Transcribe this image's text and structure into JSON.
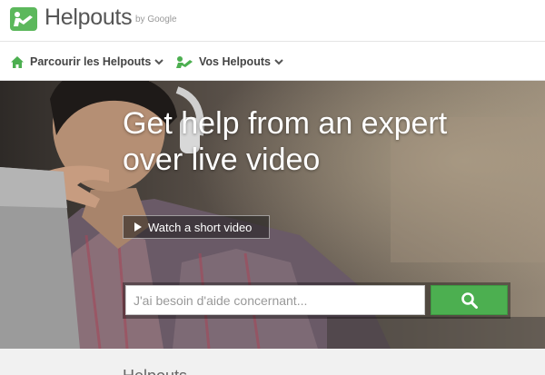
{
  "brand": {
    "name": "Helpouts",
    "by_label": "by Google",
    "accent_color": "#4caf50"
  },
  "nav": {
    "browse_label": "Parcourir les Helpouts",
    "mine_label": "Vos Helpouts"
  },
  "hero": {
    "title": "Get help from an expert over live video",
    "video_button_label": "Watch a short video",
    "search_placeholder": "J'ai besoin d'aide concernant..."
  },
  "icons": {
    "logo": "helpouts-logo-icon",
    "home": "home-icon",
    "user": "helpouts-user-icon",
    "search": "search-icon",
    "play": "play-icon",
    "chevron": "chevron-down-icon"
  },
  "bottom": {
    "partial_heading": "Helpouts …"
  }
}
